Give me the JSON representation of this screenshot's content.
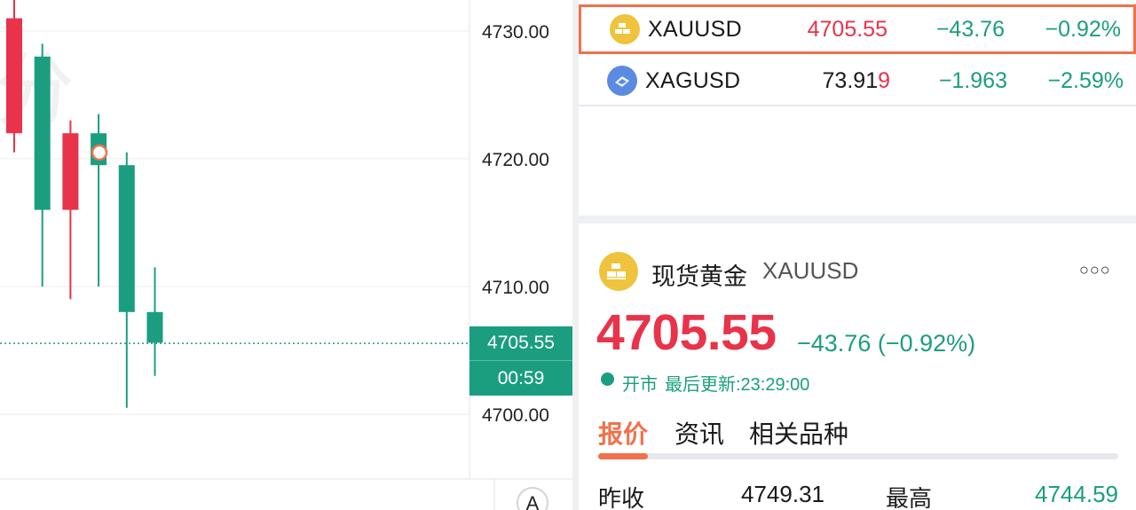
{
  "colors": {
    "up": "#e8334a",
    "down": "#1b9e80",
    "accent": "#f0714a",
    "gold_icon": "#efc43c",
    "silver_icon": "#5b8be0"
  },
  "chart": {
    "price_axis": [
      "4730.00",
      "4720.00",
      "4710.00",
      "4700.00"
    ],
    "last_price": "4705.55",
    "countdown": "00:59",
    "auto_scale_label": "A",
    "price_range": [
      4697.5,
      4732.5
    ],
    "candles": [
      {
        "open": 4722.0,
        "close": 4731.0,
        "high": 4732.5,
        "low": 4720.5
      },
      {
        "open": 4728.0,
        "close": 4716.0,
        "high": 4729.0,
        "low": 4710.0
      },
      {
        "open": 4716.0,
        "close": 4722.0,
        "high": 4723.0,
        "low": 4709.0
      },
      {
        "open": 4722.0,
        "close": 4719.5,
        "high": 4723.5,
        "low": 4710.0
      },
      {
        "open": 4719.5,
        "close": 4708.0,
        "high": 4720.5,
        "low": 4700.5
      },
      {
        "open": 4708.0,
        "close": 4705.6,
        "high": 4711.5,
        "low": 4703.0
      }
    ]
  },
  "watchlist": [
    {
      "icon": "gold-bars-icon",
      "symbol": "XAUUSD",
      "price": "4705.55",
      "price_tail": "",
      "change": "−43.76",
      "pct": "−0.92%",
      "selected": true
    },
    {
      "icon": "silver-bars-icon",
      "symbol": "XAGUSD",
      "price": "73.91",
      "price_tail": "9",
      "change": "−1.963",
      "pct": "−2.59%",
      "selected": false
    }
  ],
  "detail": {
    "name": "现货黄金",
    "symbol": "XAUUSD",
    "price": "4705.55",
    "change": "−43.76 (−0.92%)",
    "status": "开市",
    "updated": "最后更新:23:29:00",
    "more_icon": "more-icon",
    "tabs": [
      "报价",
      "资讯",
      "相关品种"
    ],
    "stats": {
      "prev_close_label": "昨收",
      "prev_close": "4749.31",
      "high_label": "最高",
      "high": "4744.59"
    }
  }
}
